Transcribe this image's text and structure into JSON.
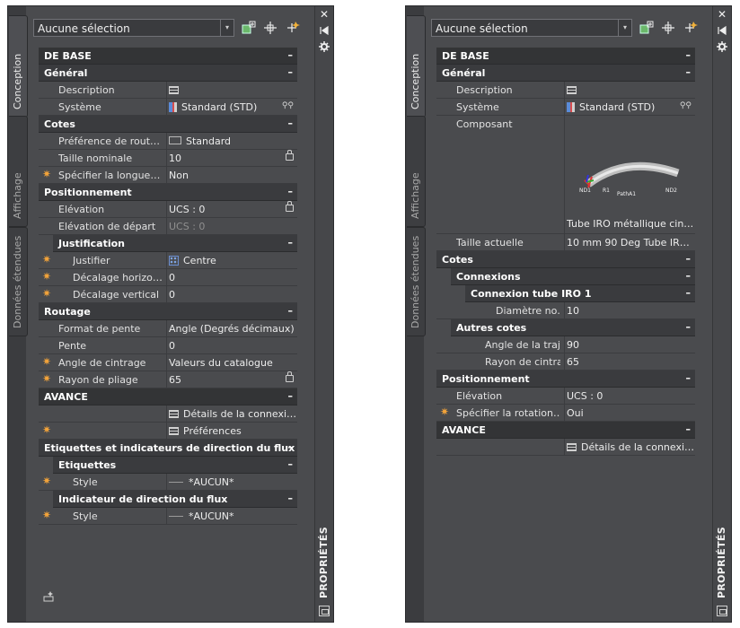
{
  "panels": [
    {
      "side_tabs": [
        "Conception",
        "Affichage",
        "Données étendues"
      ],
      "title": "PROPRIÉTÉS",
      "selection": "Aucune sélection",
      "rows": [
        {
          "type": "cat",
          "level": 0,
          "top": true,
          "label": "DE BASE",
          "toggle": "–"
        },
        {
          "type": "cat",
          "level": 0,
          "label": "Général",
          "toggle": "–"
        },
        {
          "type": "prop",
          "level": 0,
          "label": "Description",
          "value": "",
          "icon": "grid-icon"
        },
        {
          "type": "prop",
          "level": 0,
          "label": "Système",
          "value": "Standard (STD)",
          "icon": "system-icon",
          "binoc": true
        },
        {
          "type": "cat",
          "level": 0,
          "label": "Cotes",
          "toggle": "–"
        },
        {
          "type": "prop",
          "level": 0,
          "label": "Préférence de rout…",
          "value": "Standard",
          "icon": "routing-icon"
        },
        {
          "type": "prop",
          "level": 0,
          "label": "Taille nominale",
          "value": "10",
          "lock": true
        },
        {
          "type": "prop",
          "level": 0,
          "label": "Spécifier la longue…",
          "value": "Non",
          "star": true
        },
        {
          "type": "cat",
          "level": 0,
          "label": "Positionnement",
          "toggle": "–"
        },
        {
          "type": "prop",
          "level": 0,
          "label": "Elévation",
          "value": "UCS : 0",
          "lock": true
        },
        {
          "type": "prop",
          "level": 0,
          "label": "Elévation de départ",
          "value": "UCS : 0",
          "dim": true
        },
        {
          "type": "cat",
          "level": 1,
          "label": "Justification",
          "toggle": "–"
        },
        {
          "type": "prop",
          "level": 1,
          "label": "Justifier",
          "value": "Centre",
          "icon": "justify-icon",
          "star": true
        },
        {
          "type": "prop",
          "level": 1,
          "label": "Décalage  horizo…",
          "value": "0",
          "star": true
        },
        {
          "type": "prop",
          "level": 1,
          "label": "Décalage vertical",
          "value": "0",
          "star": true
        },
        {
          "type": "cat",
          "level": 0,
          "label": "Routage",
          "toggle": "–"
        },
        {
          "type": "prop",
          "level": 0,
          "label": "Format de pente",
          "value": "Angle (Degrés décimaux)"
        },
        {
          "type": "prop",
          "level": 0,
          "label": "Pente",
          "value": "0"
        },
        {
          "type": "prop",
          "level": 0,
          "label": "Angle de cintrage",
          "value": "Valeurs du catalogue",
          "star": true
        },
        {
          "type": "prop",
          "level": 0,
          "label": "Rayon de pliage",
          "value": "65",
          "star": true,
          "lock": true
        },
        {
          "type": "cat",
          "level": 0,
          "top": true,
          "label": "AVANCE",
          "toggle": "–"
        },
        {
          "type": "prop",
          "level": 0,
          "label": "",
          "value": "Détails de la connexi…",
          "icon": "grid-icon"
        },
        {
          "type": "prop",
          "level": 0,
          "label": "",
          "value": "Préférences",
          "icon": "grid-icon",
          "star": true
        },
        {
          "type": "cat",
          "level": 0,
          "label": "Etiquettes et indicateurs de direction du flux",
          "toggle": "–"
        },
        {
          "type": "cat",
          "level": 1,
          "label": "Etiquettes",
          "toggle": "–"
        },
        {
          "type": "prop",
          "level": 1,
          "label": "Style",
          "value": "*AUCUN*",
          "icon": "ucs-icon",
          "star": true
        },
        {
          "type": "cat",
          "level": 1,
          "label": "Indicateur de direction du flux",
          "toggle": "–"
        },
        {
          "type": "prop",
          "level": 1,
          "label": "Style",
          "value": "*AUCUN*",
          "icon": "ucs-icon",
          "star": true
        }
      ]
    },
    {
      "side_tabs": [
        "Conception",
        "Affichage",
        "Données étendues"
      ],
      "title": "PROPRIÉTÉS",
      "selection": "Aucune sélection",
      "rows": [
        {
          "type": "cat",
          "level": 0,
          "top": true,
          "label": "DE BASE",
          "toggle": "–"
        },
        {
          "type": "cat",
          "level": 0,
          "label": "Général",
          "toggle": "–"
        },
        {
          "type": "prop",
          "level": 0,
          "label": "Description",
          "value": "",
          "icon": "grid-icon"
        },
        {
          "type": "prop",
          "level": 0,
          "label": "Système",
          "value": "Standard (STD)",
          "icon": "system-icon",
          "binoc": true
        },
        {
          "type": "component",
          "level": 0,
          "label": "Composant",
          "value": "Tube IRO métallique cin…",
          "labels": [
            "ND1",
            "R1",
            "PathA1",
            "ND2"
          ]
        },
        {
          "type": "prop",
          "level": 0,
          "label": "Taille actuelle",
          "value": "10 mm 90 Deg Tube IR…"
        },
        {
          "type": "cat",
          "level": 0,
          "label": "Cotes",
          "toggle": "–"
        },
        {
          "type": "cat",
          "level": 1,
          "label": "Connexions",
          "toggle": "–"
        },
        {
          "type": "cat",
          "level": 2,
          "label": "Connexion tube IRO 1",
          "toggle": "–"
        },
        {
          "type": "prop",
          "level": 3,
          "label": "Diamètre  no…",
          "value": "10"
        },
        {
          "type": "cat",
          "level": 1,
          "label": "Autres cotes",
          "toggle": "–"
        },
        {
          "type": "prop",
          "level": 2,
          "label": "Angle de la traje…",
          "value": "90"
        },
        {
          "type": "prop",
          "level": 2,
          "label": "Rayon de cintra…",
          "value": "65"
        },
        {
          "type": "cat",
          "level": 0,
          "label": "Positionnement",
          "toggle": "–"
        },
        {
          "type": "prop",
          "level": 0,
          "label": "Elévation",
          "value": "UCS : 0"
        },
        {
          "type": "prop",
          "level": 0,
          "label": "Spécifier la rotation…",
          "value": "Oui",
          "star": true
        },
        {
          "type": "cat",
          "level": 0,
          "top": true,
          "label": "AVANCE",
          "toggle": "–"
        },
        {
          "type": "prop",
          "level": 0,
          "label": "",
          "value": "Détails de la connexi…",
          "icon": "grid-icon"
        }
      ]
    }
  ]
}
